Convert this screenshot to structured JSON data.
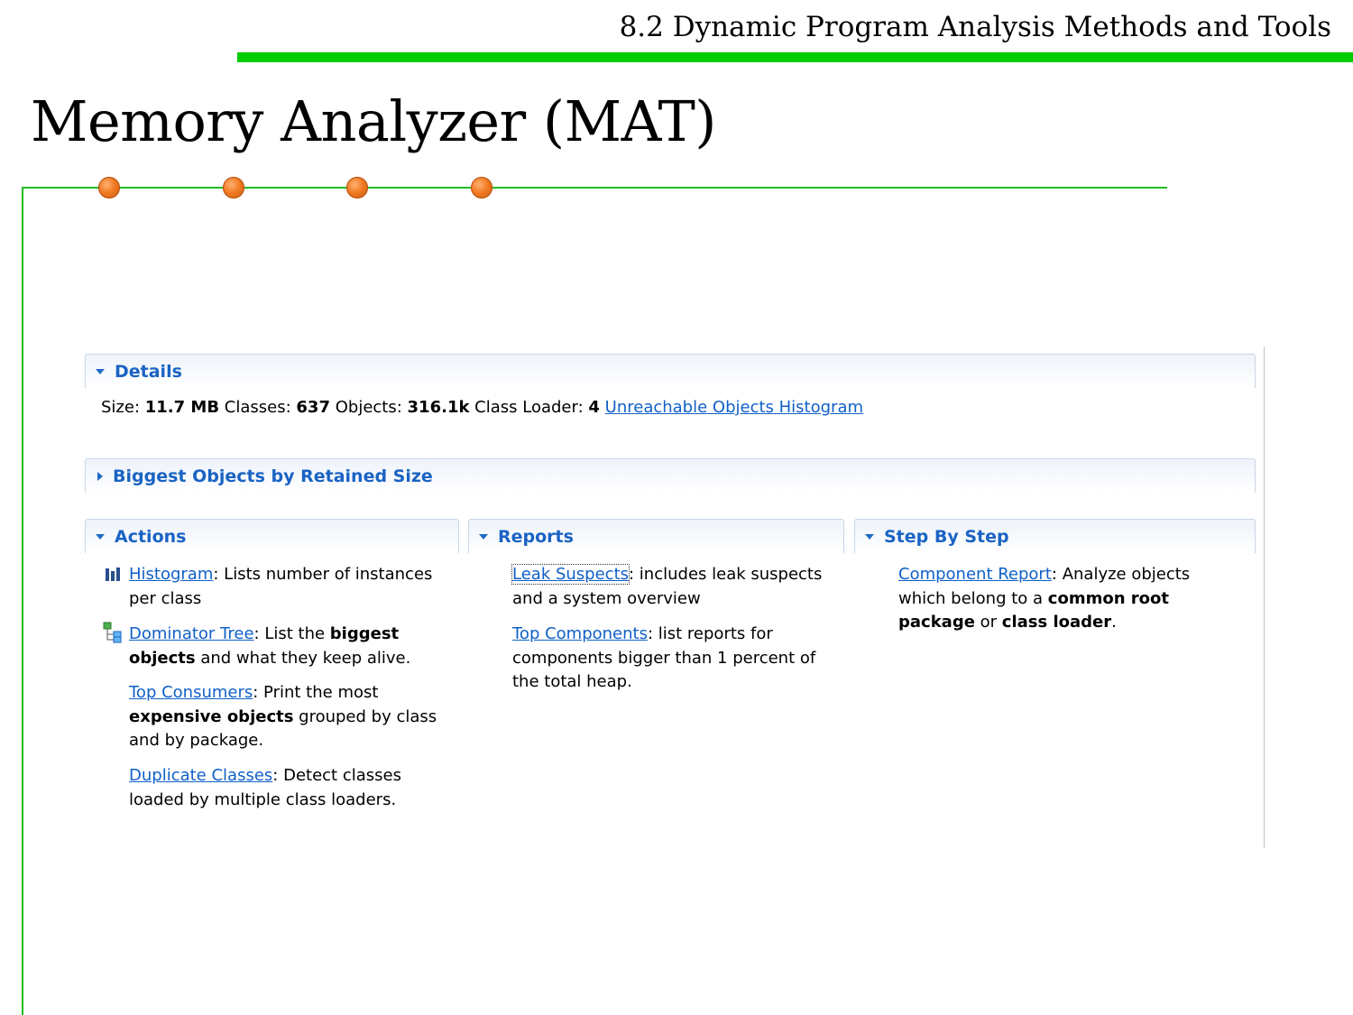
{
  "slide": {
    "section_title": "8.2 Dynamic Program Analysis Methods and Tools",
    "title": "Memory Analyzer (MAT)"
  },
  "colors": {
    "accent_green": "#00cc00",
    "dot_orange": "#f07a22",
    "link_blue": "#1060c8",
    "header_blue": "#1a63c4"
  },
  "details": {
    "header": "Details",
    "size_label": "Size:",
    "size_value": "11.7 MB",
    "classes_label": "Classes:",
    "classes_value": "637",
    "objects_label": "Objects:",
    "objects_value": "316.1k",
    "loader_label": "Class Loader:",
    "loader_value": "4",
    "unreachable_link": "Unreachable Objects Histogram"
  },
  "biggest": {
    "header": "Biggest Objects by Retained Size"
  },
  "actions": {
    "header": "Actions",
    "histogram": {
      "link": "Histogram",
      "text1": ": Lists number of instances",
      "text2": "per class",
      "icon": "histogram-icon"
    },
    "dominator": {
      "link": "Dominator Tree",
      "text1": ": List the ",
      "bold1": "biggest",
      "bold2": "objects",
      "text2": " and what they keep alive.",
      "icon": "dominator-tree-icon"
    },
    "consumers": {
      "link": "Top Consumers",
      "text1": ": Print the most",
      "bold1": "expensive objects",
      "text2": " grouped by class",
      "text3": "and by package."
    },
    "duplicate": {
      "link": "Duplicate Classes",
      "text1": ": Detect classes",
      "text2": "loaded by multiple class loaders."
    }
  },
  "reports": {
    "header": "Reports",
    "leak": {
      "link": "Leak Suspects",
      "text1": ": includes leak suspects",
      "text2": "and a system overview"
    },
    "components": {
      "link": "Top Components",
      "text1": ": list reports for",
      "text2": "components bigger than 1 percent of",
      "text3": "the total heap."
    }
  },
  "stepbystep": {
    "header": "Step By Step",
    "component": {
      "link": "Component Report",
      "text1": ": Analyze objects",
      "text2": "which belong to a ",
      "bold1": "common root",
      "bold2": "package",
      "text3": " or ",
      "bold3": "class loader",
      "text4": "."
    }
  }
}
